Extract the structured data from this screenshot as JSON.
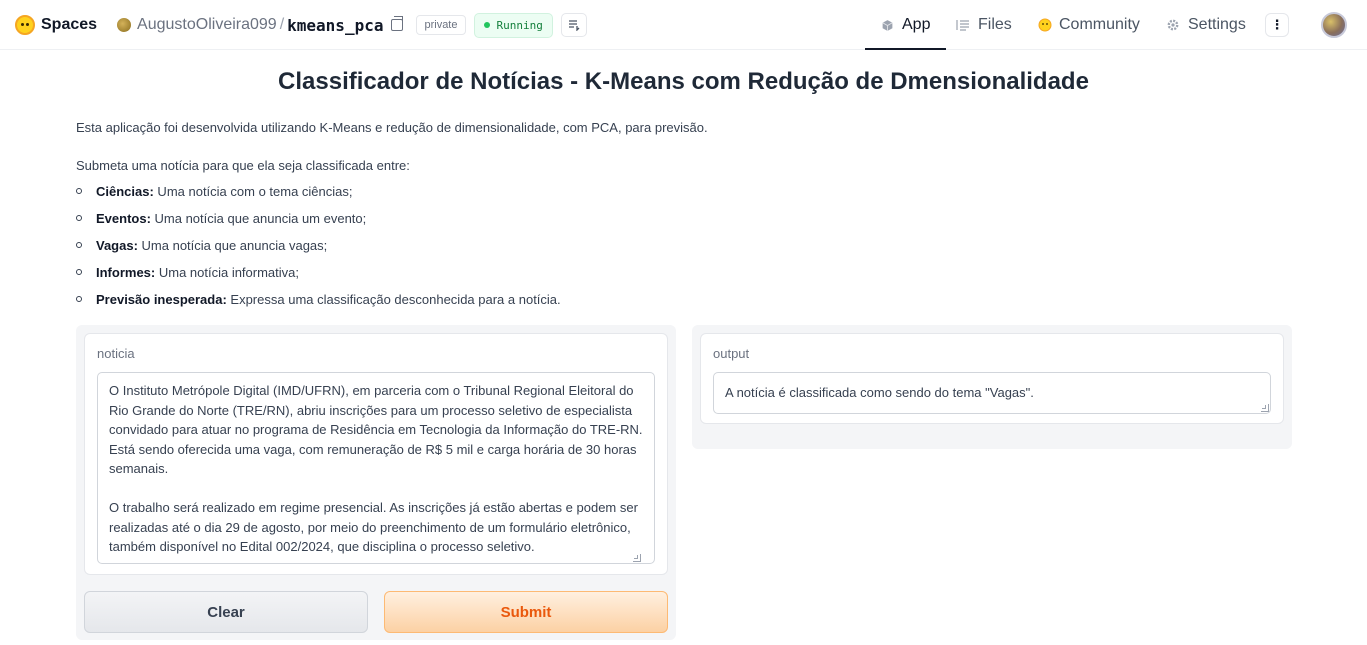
{
  "header": {
    "brand": "Spaces",
    "owner": "AugustoOliveira099",
    "separator": "/",
    "repo": "kmeans_pca",
    "visibility": "private",
    "status": "Running",
    "tabs": [
      {
        "label": "App",
        "icon": "cube-icon",
        "active": true
      },
      {
        "label": "Files",
        "icon": "files-icon",
        "active": false
      },
      {
        "label": "Community",
        "icon": "hug-icon",
        "active": false
      },
      {
        "label": "Settings",
        "icon": "gear-icon",
        "active": false
      }
    ]
  },
  "main": {
    "title": "Classificador de Notícias - K-Means com Redução de Dmensionalidade",
    "description": "Esta aplicação foi desenvolvida utilizando K-Means e redução de dimensionalidade, com PCA, para previsão.",
    "intro": "Submeta uma notícia para que ela seja classificada entre:",
    "categories": [
      {
        "name": "Ciências:",
        "text": " Uma notícia com o tema ciências;"
      },
      {
        "name": "Eventos:",
        "text": " Uma notícia que anuncia um evento;"
      },
      {
        "name": "Vagas:",
        "text": " Uma notícia que anuncia vagas;"
      },
      {
        "name": "Informes:",
        "text": " Uma notícia informativa;"
      },
      {
        "name": "Previsão inesperada:",
        "text": " Expressa uma classificação desconhecida para a notícia."
      }
    ]
  },
  "input": {
    "label": "noticia",
    "value": "O Instituto Metrópole Digital (IMD/UFRN), em parceria com o Tribunal Regional Eleitoral do Rio Grande do Norte (TRE/RN), abriu inscrições para um processo seletivo de especialista convidado para atuar no programa de Residência em Tecnologia da Informação do TRE-RN. Está sendo oferecida uma vaga, com remuneração de R$ 5 mil e carga horária de 30 horas semanais.\n\nO trabalho será realizado em regime presencial. As inscrições já estão abertas e podem ser realizadas até o dia 29 de agosto, por meio do preenchimento de um formulário eletrônico, também disponível no Edital 002/2024, que disciplina o processo seletivo."
  },
  "output": {
    "label": "output",
    "value": "A notícia é classificada como sendo do tema \"Vagas\"."
  },
  "buttons": {
    "clear": "Clear",
    "submit": "Submit"
  },
  "colors": {
    "accent": "#ea580c",
    "running": "#22c55e"
  }
}
